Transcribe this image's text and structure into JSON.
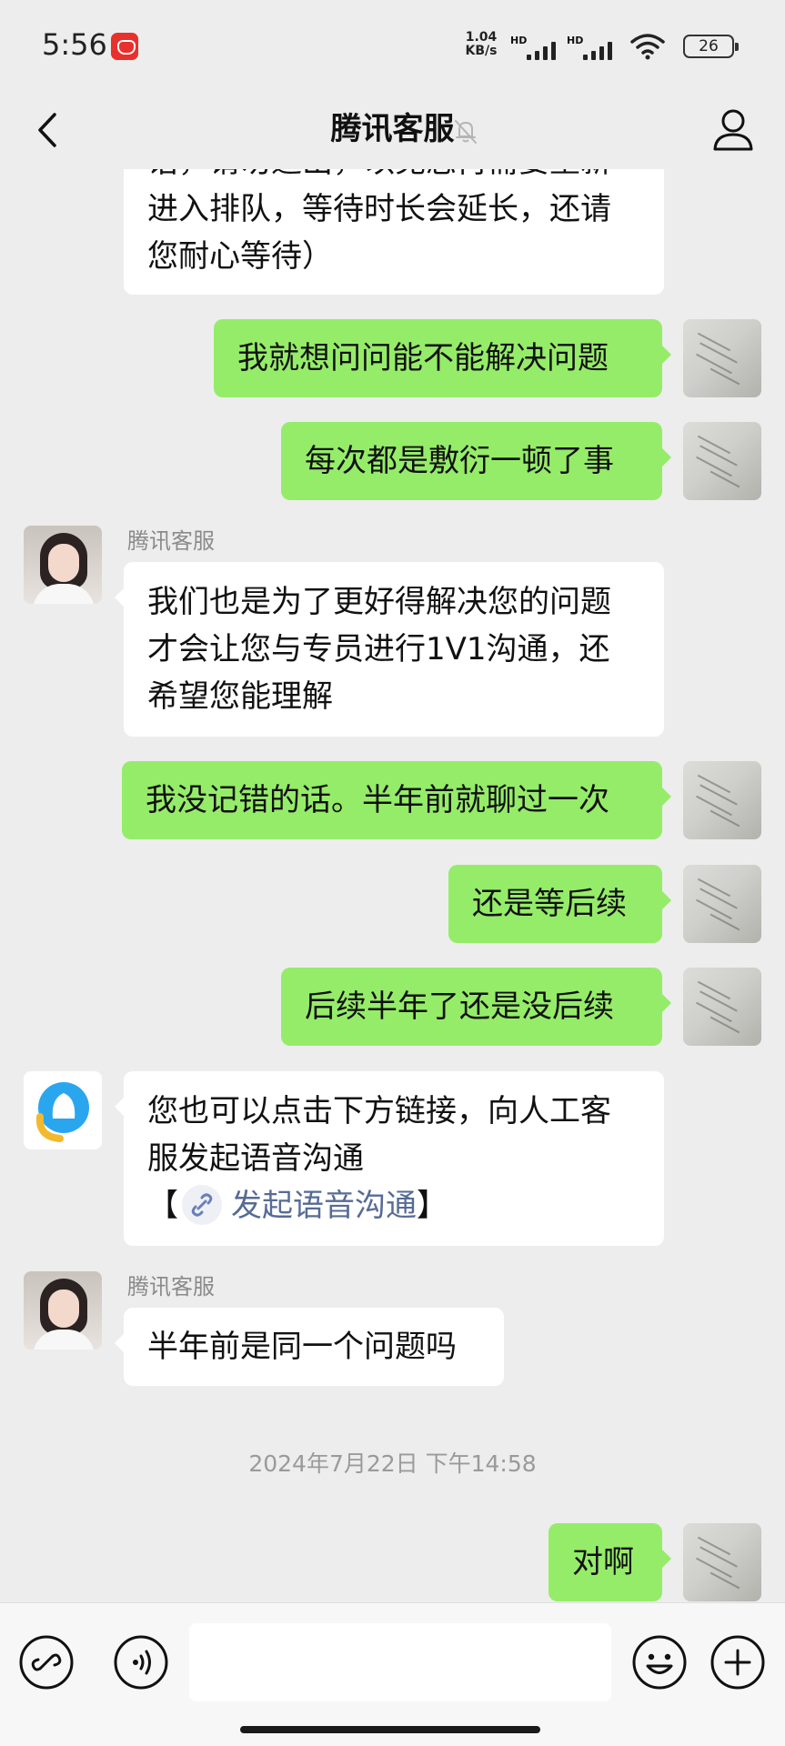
{
  "status_bar": {
    "time": "5:56",
    "net_speed_value": "1.04",
    "net_speed_unit": "KB/s",
    "sim1_label": "HD",
    "sim2_label": "HD",
    "battery": "26"
  },
  "header": {
    "title": "腾讯客服",
    "icons": {
      "back": "back-icon",
      "mute": "mute-bell-icon",
      "profile": "profile-icon"
    }
  },
  "messages": [
    {
      "from": "agent",
      "lines": [
        "话，请勿退出，以免您再需要重新",
        "进入排队，等待时长会延长，还请",
        "您耐心等待）"
      ]
    },
    {
      "from": "user",
      "lines": [
        "我就想问问能不能解决问题"
      ]
    },
    {
      "from": "user",
      "lines": [
        "每次都是敷衍一顿了事"
      ]
    },
    {
      "from": "agent",
      "sender": "腾讯客服",
      "lines": [
        "我们也是为了更好得解决您的问题",
        "才会让您与专员进行1V1沟通，还",
        "希望您能理解"
      ]
    },
    {
      "from": "user",
      "lines": [
        "我没记错的话。半年前就聊过一次"
      ]
    },
    {
      "from": "user",
      "lines": [
        "还是等后续"
      ]
    },
    {
      "from": "user",
      "lines": [
        "后续半年了还是没后续"
      ]
    },
    {
      "from": "bot",
      "lines": [
        "您也可以点击下方链接，向人工客",
        "服发起语音沟通"
      ],
      "link": {
        "open_bracket": "【",
        "text": "发起语音沟通",
        "close_bracket": "】"
      }
    },
    {
      "from": "agent",
      "sender": "腾讯客服",
      "lines": [
        "半年前是同一个问题吗"
      ]
    },
    {
      "from": "user",
      "lines": [
        "对啊"
      ]
    }
  ],
  "timestamp": "2024年7月22日 下午14:58",
  "input_bar": {
    "placeholder": "",
    "icons": {
      "mini_program": "mini-program-icon",
      "voice": "voice-icon",
      "emoji": "emoji-icon",
      "more": "plus-icon"
    }
  },
  "colors": {
    "background": "#ededed",
    "outgoing_bubble": "#95ec69",
    "incoming_bubble": "#ffffff",
    "link": "#576b95"
  }
}
